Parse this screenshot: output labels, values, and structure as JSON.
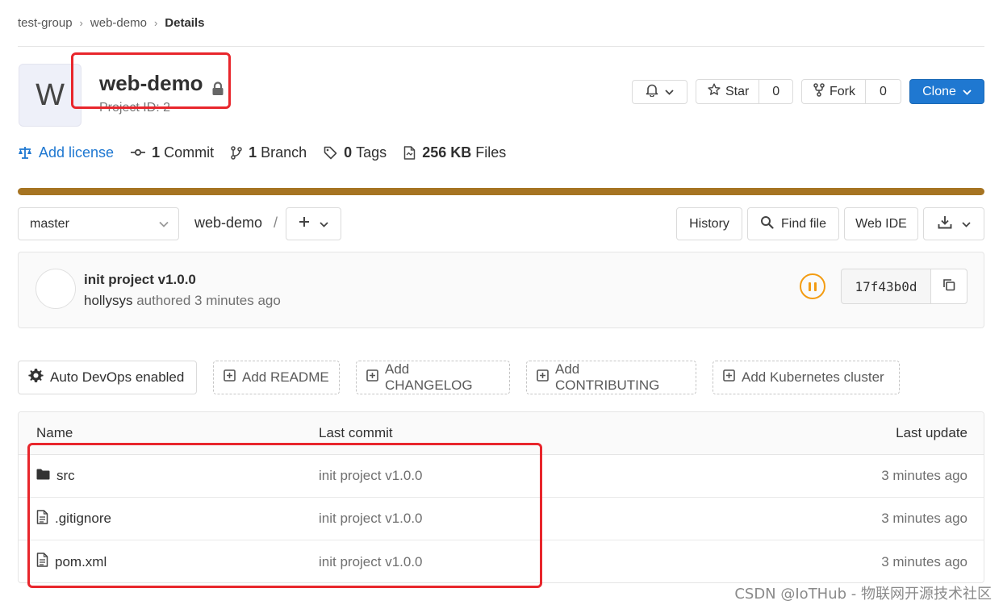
{
  "breadcrumb": [
    "test-group",
    "web-demo",
    "Details"
  ],
  "project": {
    "avatar_letter": "W",
    "name": "web-demo",
    "id_text": "Project ID: 2",
    "visibility_icon": "lock-icon"
  },
  "actions": {
    "star_label": "Star",
    "star_count": "0",
    "fork_label": "Fork",
    "fork_count": "0",
    "clone_label": "Clone"
  },
  "stats": {
    "license_label": "Add license",
    "commits_count": "1",
    "commits_label": "Commit",
    "branches_count": "1",
    "branches_label": "Branch",
    "tags_count": "0",
    "tags_label": "Tags",
    "size_value": "256 KB",
    "size_label": "Files"
  },
  "language_bar_color": "#a67422",
  "tree": {
    "branch": "master",
    "path": "web-demo",
    "history_label": "History",
    "find_file_label": "Find file",
    "web_ide_label": "Web IDE"
  },
  "last_commit": {
    "title": "init project v1.0.0",
    "author": "hollysys",
    "meta": "authored 3 minutes ago",
    "sha": "17f43b0d",
    "pipeline_status": "paused"
  },
  "quick_actions": {
    "auto_devops": "Auto DevOps enabled",
    "add_readme": "Add README",
    "add_changelog": "Add CHANGELOG",
    "add_contributing": "Add CONTRIBUTING",
    "add_k8s": "Add Kubernetes cluster"
  },
  "files": {
    "headers": {
      "name": "Name",
      "last_commit": "Last commit",
      "last_update": "Last update"
    },
    "rows": [
      {
        "name": "src",
        "icon": "folder-icon",
        "commit": "init project v1.0.0",
        "updated": "3 minutes ago"
      },
      {
        "name": ".gitignore",
        "icon": "file-icon",
        "commit": "init project v1.0.0",
        "updated": "3 minutes ago"
      },
      {
        "name": "pom.xml",
        "icon": "file-icon",
        "commit": "init project v1.0.0",
        "updated": "3 minutes ago"
      }
    ]
  },
  "annotation_color": "#e8262c",
  "watermark": "CSDN @IoTHub - 物联网开源技术社区"
}
